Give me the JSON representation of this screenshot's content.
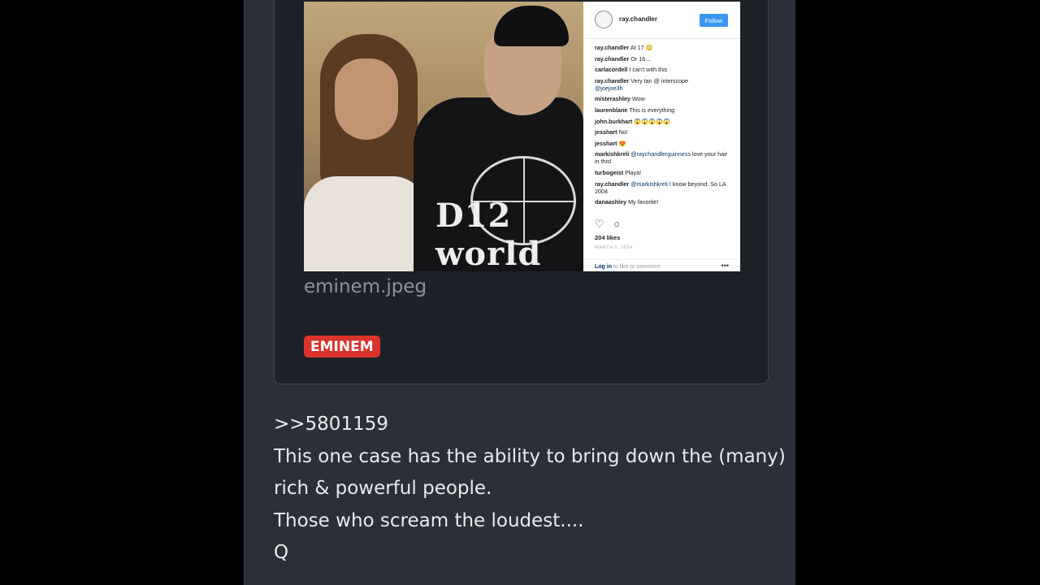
{
  "instagram": {
    "username": "ray.chandler",
    "follow_label": "Follow",
    "comments": [
      {
        "user": "ray.chandler",
        "text": "At 17 😳"
      },
      {
        "user": "ray.chandler",
        "text": "Or 16..."
      },
      {
        "user": "carlacordell",
        "text": "I can't with this"
      },
      {
        "user": "ray.chandler",
        "text": "Very tan @ interscope",
        "mention": "@joejoe3h"
      },
      {
        "user": "misterashley",
        "text": "Wow"
      },
      {
        "user": "laurenblane",
        "text": "This is everything"
      },
      {
        "user": "john.burkhart",
        "text": "😱😱😱😱😱"
      },
      {
        "user": "jesshart",
        "text": "No!"
      },
      {
        "user": "jesshart",
        "text": "😍"
      },
      {
        "user": "markishkreli",
        "mention": "@raychandlerguinness",
        "text": "love your hair in this!"
      },
      {
        "user": "turbogeist",
        "text": "Playa!"
      },
      {
        "user": "ray.chandler",
        "mention": "@markishkreli",
        "text": "I know beyond. So LA 2004"
      },
      {
        "user": "danaashley",
        "text": "My favorite!"
      }
    ],
    "heart_icon": "♡",
    "comment_icon": "○",
    "likes": "204 likes",
    "date": "MARCH 5, 2014",
    "login_link": "Log in",
    "login_text": "to like or comment.",
    "more_icon": "•••"
  },
  "shirt_text": "D12 world",
  "file_name": "eminem.jpeg",
  "tag_label": "EMINEM",
  "post": {
    "lines": [
      ">>5801159",
      "This one case has the ability to bring down the (many)",
      "rich & powerful people.",
      "Those who scream the loudest....",
      "Q"
    ]
  },
  "colors": {
    "page_background": "#000000",
    "panel_background": "#2b3038",
    "card_background": "#1e2128",
    "tag_background": "#d9332b",
    "post_text": "#e8eaed",
    "filename_text": "#8c929b",
    "follow_button": "#3897f0"
  }
}
